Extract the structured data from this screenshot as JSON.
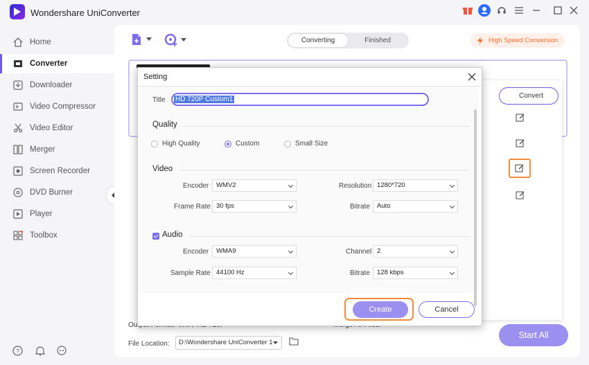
{
  "app": {
    "title": "Wondershare UniConverter"
  },
  "sidebar": {
    "items": [
      {
        "label": "Home",
        "icon": "home-icon"
      },
      {
        "label": "Converter",
        "icon": "converter-icon",
        "active": true
      },
      {
        "label": "Downloader",
        "icon": "download-icon"
      },
      {
        "label": "Video Compressor",
        "icon": "compress-icon"
      },
      {
        "label": "Video Editor",
        "icon": "scissors-icon"
      },
      {
        "label": "Merger",
        "icon": "merge-icon"
      },
      {
        "label": "Screen Recorder",
        "icon": "record-icon"
      },
      {
        "label": "DVD Burner",
        "icon": "disc-icon"
      },
      {
        "label": "Player",
        "icon": "play-icon"
      },
      {
        "label": "Toolbox",
        "icon": "grid-icon"
      }
    ]
  },
  "main": {
    "tabs": [
      {
        "label": "Converting"
      },
      {
        "label": "Finished"
      }
    ],
    "high_speed": "High Speed Conversion",
    "convert_label": "Convert",
    "output_format_label": "Output Format:",
    "output_format_value": "WMV HD 720P",
    "merge_label": "Merge All Files:",
    "file_location_label": "File Location:",
    "file_location_value": "D:\\Wondershare UniConverter 1",
    "start_all": "Start All"
  },
  "dialog": {
    "title": "Setting",
    "title_label": "Title",
    "title_value": "HD 720P Custom1",
    "quality_label": "Quality",
    "quality_options": [
      "High Quality",
      "Custom",
      "Small Size"
    ],
    "quality_selected": "Custom",
    "video_label": "Video",
    "video": {
      "encoder_label": "Encoder",
      "encoder": "WMV2",
      "resolution_label": "Resolution",
      "resolution": "1280*720",
      "frame_rate_label": "Frame Rate",
      "frame_rate": "30 fps",
      "bitrate_label": "Bitrate",
      "bitrate": "Auto"
    },
    "audio_label": "Audio",
    "audio_checked": true,
    "audio": {
      "encoder_label": "Encoder",
      "encoder": "WMA9",
      "channel_label": "Channel",
      "channel": "2",
      "sample_rate_label": "Sample Rate",
      "sample_rate": "44100 Hz",
      "bitrate_label": "Bitrate",
      "bitrate": "128 kbps"
    },
    "create": "Create",
    "cancel": "Cancel"
  },
  "colors": {
    "accent": "#6d5ce7",
    "highlight": "#f08a3c",
    "high_speed": "#ff6a2a"
  }
}
